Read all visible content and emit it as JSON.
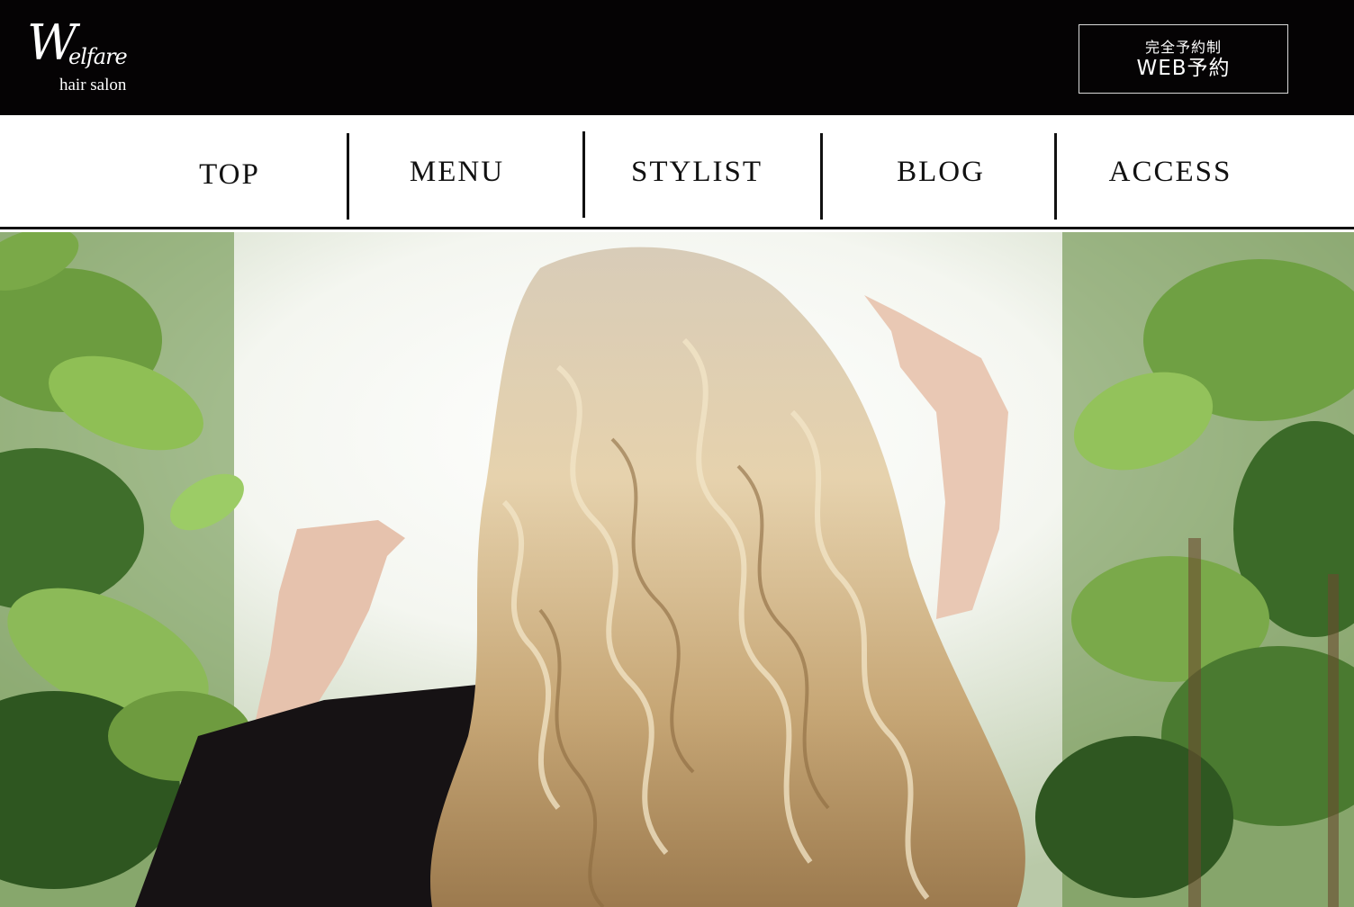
{
  "header": {
    "logo_mark": "W",
    "logo_word": "elfare",
    "logo_sub": "hair salon",
    "reserve_button": {
      "top_label": "完全予約制",
      "main_label": "WEB予約"
    }
  },
  "nav": {
    "items": [
      {
        "label": "TOP"
      },
      {
        "label": "MENU"
      },
      {
        "label": "STYLIST"
      },
      {
        "label": "BLOG"
      },
      {
        "label": "ACCESS"
      }
    ]
  },
  "hero": {
    "image": "photo of a woman with long wavy blonde hair seen from behind among green plants"
  },
  "colors": {
    "header_bg": "#050304",
    "nav_text": "#111111",
    "accent_white": "#ffffff"
  }
}
